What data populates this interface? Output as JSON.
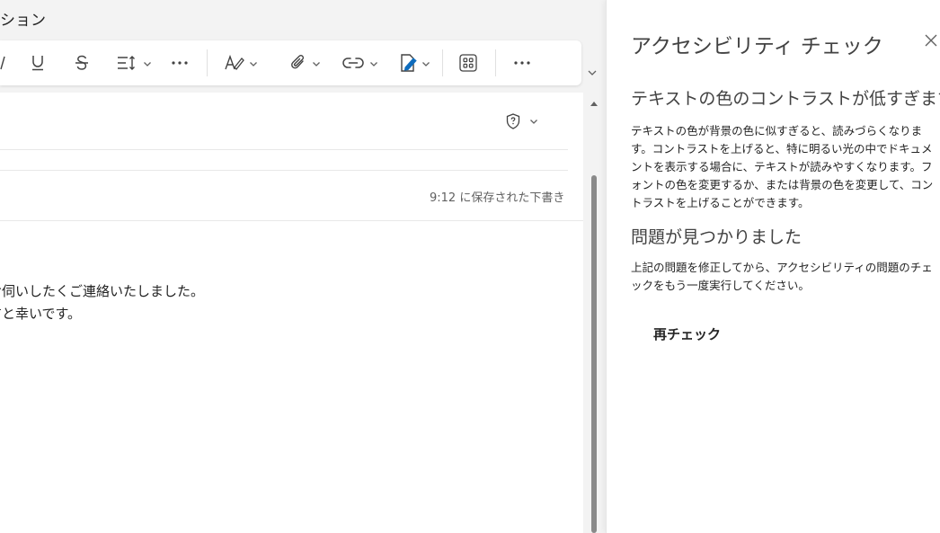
{
  "tab": {
    "label": "ション"
  },
  "toolbar": {
    "icons": [
      "underline-icon",
      "strikethrough-icon",
      "line-spacing-icon",
      "more-icon",
      "format-painter-icon",
      "attach-icon",
      "link-icon",
      "signature-icon",
      "apps-icon",
      "more-options-icon"
    ]
  },
  "compose": {
    "saved_status": "9:12 に保存された下書き",
    "body_lines": [
      "お伺いしたくご連絡いたしました。",
      "すと幸いです。"
    ]
  },
  "panel": {
    "title": "アクセシビリティ チェック",
    "issue_heading": "テキストの色のコントラストが低すぎます",
    "issue_description": "テキストの色が背景の色に似すぎると、読みづらくなります。コントラストを上げると、特に明るい光の中でドキュメントを表示する場合に、テキストが読みやすくなります。フォントの色を変更するか、または背景の色を変更して、コントラストを上げることができます。",
    "found_heading": "問題が見つかりました",
    "found_description": "上記の問題を修正してから、アクセシビリティの問題のチェックをもう一度実行してください。",
    "recheck_label": "再チェック"
  },
  "colors": {
    "background": "#f3f3f3",
    "surface": "#ffffff",
    "scroll_thumb": "#8a8a8a",
    "signature_blue": "#0f6cbd"
  }
}
